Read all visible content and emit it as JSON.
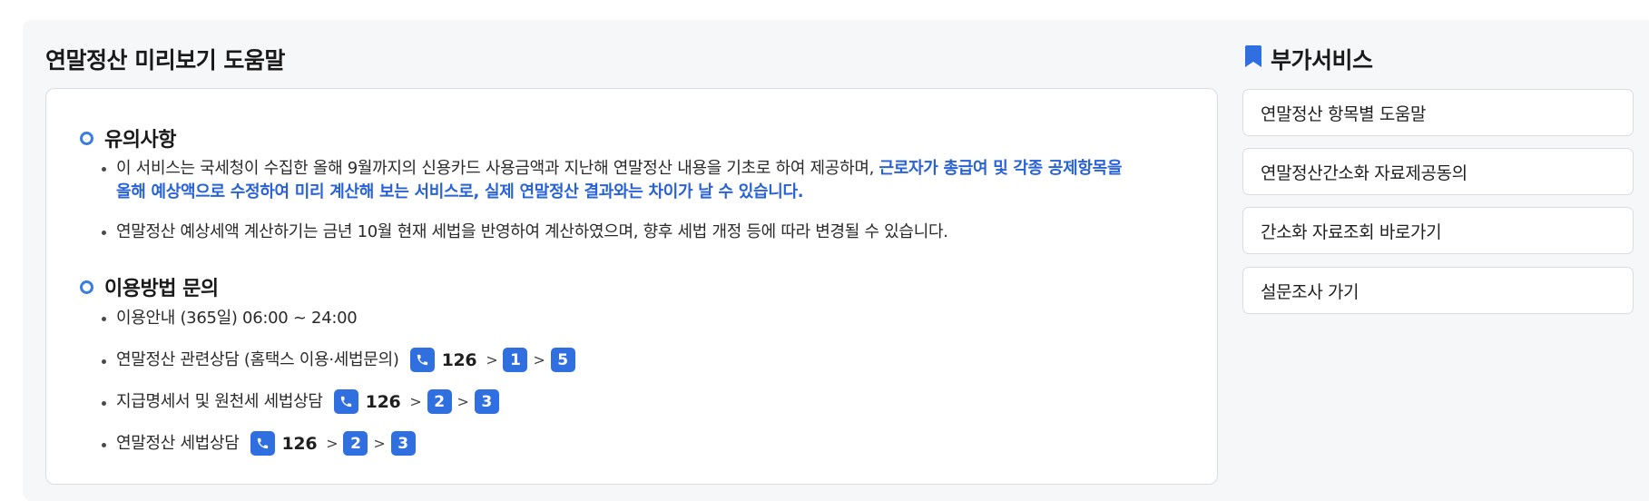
{
  "main": {
    "title": "연말정산 미리보기 도움말",
    "notice": {
      "title": "유의사항",
      "item1_plain": "이 서비스는 국세청이 수집한 올해 9월까지의 신용카드 사용금액과 지난해 연말정산 내용을 기초로 하여 제공하며, ",
      "item1_hl1": "근로자가 총급여 및 각종 공제항목을",
      "item1_hl2": "올해 예상액으로 수정하여 미리 계산해 보는 서비스로, 실제 연말정산 결과와는 차이가 날 수 있습니다.",
      "item2": "연말정산 예상세액 계산하기는 금년 10월 현재 세법을 반영하여 계산하였으며, 향후 세법 개정 등에 따라 변경될 수 있습니다."
    },
    "contact": {
      "title": "이용방법 문의",
      "hours": "이용안내 (365일) 06:00 ~ 24:00",
      "lines": [
        {
          "label": "연말정산 관련상담 (홈택스 이용·세법문의)",
          "number": "126",
          "keys": [
            "1",
            "5"
          ]
        },
        {
          "label": "지급명세서 및 원천세 세법상담",
          "number": "126",
          "keys": [
            "2",
            "3"
          ]
        },
        {
          "label": "연말정산 세법상담",
          "number": "126",
          "keys": [
            "2",
            "3"
          ]
        }
      ],
      "arrow": ">"
    }
  },
  "sidebar": {
    "title": "부가서비스",
    "icon": "bookmark-icon",
    "items": [
      {
        "label": "연말정산 항목별 도움말"
      },
      {
        "label": "연말정산간소화 자료제공동의"
      },
      {
        "label": "간소화 자료조회 바로가기"
      },
      {
        "label": "설문조사 가기"
      }
    ]
  },
  "colors": {
    "accent": "#2f6fe0",
    "highlight_text": "#2962d6",
    "panel_bg": "#f6f7f9",
    "border": "#d9dde3"
  }
}
